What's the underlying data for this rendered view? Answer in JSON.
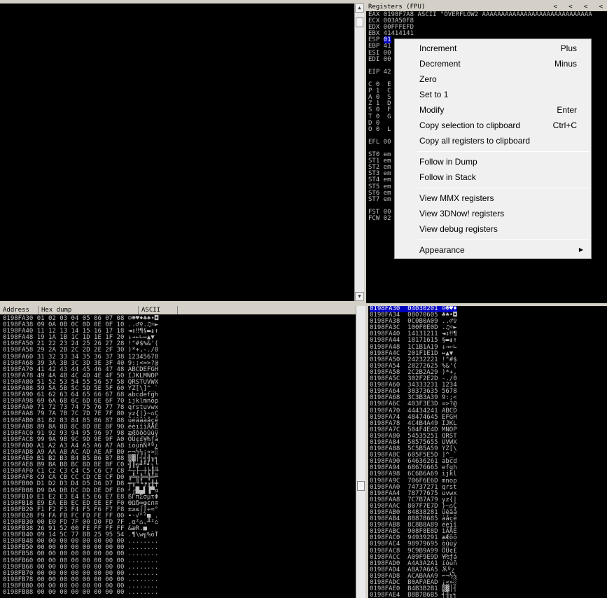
{
  "registers": {
    "header": "Registers (FPU)",
    "nav": "<   <   <   <",
    "lines": [
      "EAX 0198F7A8 ASCII \"OVERFLOW2 AAAAAAAAAAAAAAAAAAAAAAAAAAAAA",
      "ECX 003A50F8",
      "EDX 00FFFEFD",
      "EBX 41414141",
      "ESP 01",
      "EBP 41",
      "ESI 00",
      "EDI 00",
      "",
      "EIP 42",
      "",
      "C 0  E",
      "P 1  C",
      "A 0  S",
      "Z 1  D",
      "S 0  F",
      "T 0  G",
      "D 0",
      "O 0  L",
      "",
      "EFL 00",
      "",
      "ST0 em",
      "ST1 em",
      "ST2 em",
      "ST3 em",
      "ST4 em",
      "ST5 em",
      "ST6 em",
      "ST7 em",
      "",
      "FST 00",
      "FCW 02"
    ]
  },
  "context_menu": {
    "items": [
      {
        "label": "Increment",
        "shortcut": "Plus"
      },
      {
        "label": "Decrement",
        "shortcut": "Minus"
      },
      {
        "label": "Zero",
        "shortcut": ""
      },
      {
        "label": "Set to 1",
        "shortcut": ""
      },
      {
        "label": "Modify",
        "shortcut": "Enter"
      },
      {
        "label": "Copy selection to clipboard",
        "shortcut": "Ctrl+C"
      },
      {
        "label": "Copy all registers to clipboard",
        "shortcut": ""
      },
      {
        "label": "Follow in Dump",
        "shortcut": ""
      },
      {
        "label": "Follow in Stack",
        "shortcut": ""
      },
      {
        "label": "View MMX registers",
        "shortcut": ""
      },
      {
        "label": "View 3DNow! registers",
        "shortcut": ""
      },
      {
        "label": "View debug registers",
        "shortcut": ""
      },
      {
        "label": "Appearance",
        "shortcut": ""
      }
    ],
    "submenu_arrow": "▶"
  },
  "dump": {
    "columns": [
      "Address",
      "Hex dump",
      "ASCII"
    ],
    "rows": [
      "0198FA30 01 02 03 04 05 06 07 08 ☺☻♥♦♣♠•◘",
      "0198FA38 09 0A 0B 0C 0D 0E 0F 10 ..♂♀.♫☼►",
      "0198FA40 11 12 13 14 15 16 17 18 ◄↕‼¶§▬↨↑",
      "0198FA48 19 1A 1B 1C 1D 1E 1F 20 ↓→←∟↔▲▼ ",
      "0198FA50 21 22 23 24 25 26 27 28 !\"#$%&'(",
      "0198FA58 29 2A 2B 2C 2D 2E 2F 30 )*+,-./0",
      "0198FA60 31 32 33 34 35 36 37 38 12345678",
      "0198FA68 39 3A 3B 3C 3D 3E 3F 40 9:;<=>?@",
      "0198FA70 41 42 43 44 45 46 47 48 ABCDEFGH",
      "0198FA78 49 4A 4B 4C 4D 4E 4F 50 IJKLMNOP",
      "0198FA80 51 52 53 54 55 56 57 58 QRSTUVWX",
      "0198FA88 59 5A 5B 5C 5D 5E 5F 60 YZ[\\]^_`",
      "0198FA90 61 62 63 64 65 66 67 68 abcdefgh",
      "0198FA98 69 6A 6B 6C 6D 6E 6F 70 ijklmnop",
      "0198FAA0 71 72 73 74 75 76 77 78 qrstuvwx",
      "0198FAA8 79 7A 7B 7C 7D 7E 7F 80 yz{|}~⌂Ç",
      "0198FAB0 81 82 83 84 85 86 87 88 üéâäàåçê",
      "0198FAB8 89 8A 8B 8C 8D 8E 8F 90 ëèïîìÄÅÉ",
      "0198FAC0 91 92 93 94 95 96 97 98 æÆôöòûùÿ",
      "0198FAC8 99 9A 9B 9C 9D 9E 9F A0 ÖÜ¢£¥₧ƒá",
      "0198FAD0 A1 A2 A3 A4 A5 A6 A7 A8 íóúñÑªº¿",
      "0198FAD8 A9 AA AB AC AD AE AF B0 ⌐¬½¼¡«»░",
      "0198FAE0 B1 B2 B3 B4 B5 B6 B7 B8 ▒▓│┤╡╢╖╕",
      "0198FAE8 B9 BA BB BC BD BE BF C0 ╣║╗╝╜╛┐└",
      "0198FAF0 C1 C2 C3 C4 C5 C6 C7 C8 ┴┬├─┼╞╟╚",
      "0198FAF8 C9 CA CB CC CD CE CF D0 ╔╩╦╠═╬╧╨",
      "0198FB00 D1 D2 D3 D4 D5 D6 D7 D8 ╤╥╙╘╒╓╫╪",
      "0198FB08 D9 DA DB DC DD DE DF E0 ┘┌█▄▌▐▀α",
      "0198FB10 E1 E2 E3 E4 E5 E6 E7 E8 ßΓπΣσµτΦ",
      "0198FB18 E9 EA EB EC ED EE EF F0 ΘΩδ∞φε∩≡",
      "0198FB20 F1 F2 F3 F4 F5 F6 F7 F8 ±≥≤⌠⌡÷≈°",
      "0198FB28 F9 FA FB FC FD FE FF 00 ∙·√ⁿ²■ .",
      "0198FB30 00 E0 FD 7F 00 D0 FD 7F .α²⌂.╨²⌂",
      "0198FB38 26 91 52 00 FE FF FF FF &æR.■   ",
      "0198FB40 09 14 5C 77 BB 25 95 54 .¶\\w╗%òT",
      "0198FB48 00 00 00 00 00 00 00 00 ........",
      "0198FB50 00 00 00 00 00 00 00 00 ........",
      "0198FB58 00 00 00 00 00 00 00 00 ........",
      "0198FB60 00 00 00 00 00 00 00 00 ........",
      "0198FB68 00 00 00 00 00 00 00 00 ........",
      "0198FB70 00 00 00 00 00 00 00 00 ........",
      "0198FB78 00 00 00 00 00 00 00 00 ........",
      "0198FB80 00 00 00 00 00 00 00 00 ........",
      "0198FB88 00 00 00 00 00 00 00 00 ........"
    ]
  },
  "stack": {
    "rows": [
      "0198FA30  04030201 ☺☻♥♦",
      "0198FA34  08070605 ♣♠•◘",
      "0198FA38  0C0B0A09 ..♂♀",
      "0198FA3C  100F0E0D .♫☼►",
      "0198FA40  14131211 ◄↕‼¶",
      "0198FA44  18171615 §▬↨↑",
      "0198FA48  1C1B1A19 ↓→←∟",
      "0198FA4C  201F1E1D ↔▲▼ ",
      "0198FA50  24232221 !\"#$",
      "0198FA54  28272625 %&'(",
      "0198FA58  2C2B2A29 )*+,",
      "0198FA5C  302F2E2D -./0",
      "0198FA60  34333231 1234",
      "0198FA64  38373635 5678",
      "0198FA68  3C3B3A39 9:;<",
      "0198FA6C  403F3E3D =>?@",
      "0198FA70  44434241 ABCD",
      "0198FA74  48474645 EFGH",
      "0198FA78  4C4B4A49 IJKL",
      "0198FA7C  504F4E4D MNOP",
      "0198FA80  54535251 QRST",
      "0198FA84  58575655 UVWX",
      "0198FA88  5C5B5A59 YZ[\\",
      "0198FA8C  605F5E5D ]^_`",
      "0198FA90  64636261 abcd",
      "0198FA94  68676665 efgh",
      "0198FA98  6C6B6A69 ijkl",
      "0198FA9C  706F6E6D mnop",
      "0198FAA0  74737271 qrst",
      "0198FAA4  78777675 uvwx",
      "0198FAA8  7C7B7A79 yz{|",
      "0198FAAC  807F7E7D }~⌂Ç",
      "0198FAB0  84838281 üéâä",
      "0198FAB4  88878685 àåçê",
      "0198FAB8  8C8B8A89 ëèïî",
      "0198FABC  908F8E8D ìÄÅÉ",
      "0198FAC0  94939291 æÆôö",
      "0198FAC4  98979695 òûùÿ",
      "0198FAC8  9C9B9A99 ÖÜ¢£",
      "0198FACC  A09F9E9D ¥₧ƒá",
      "0198FAD0  A4A3A2A1 íóúñ",
      "0198FAD4  A8A7A6A5 Ѫº¿",
      "0198FAD8  ACABAAA9 ⌐¬½¼",
      "0198FADC  B0AFAEAD ¡«»░",
      "0198FAE0  B4B3B2B1 ▒▓│┤",
      "0198FAE4  B8B7B6B5 ╡╢╖╕"
    ]
  }
}
